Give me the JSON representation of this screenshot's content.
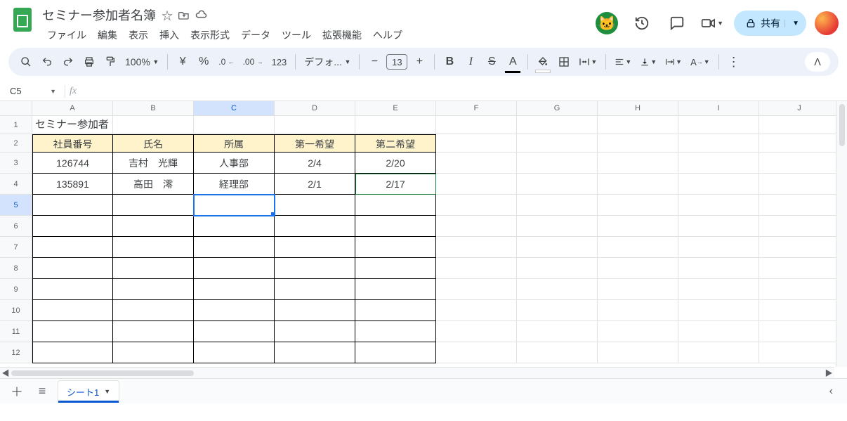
{
  "doc": {
    "title": "セミナー参加者名簿"
  },
  "menu": {
    "file": "ファイル",
    "edit": "編集",
    "view": "表示",
    "insert": "挿入",
    "format": "表示形式",
    "data": "データ",
    "tools": "ツール",
    "extensions": "拡張機能",
    "help": "ヘルプ"
  },
  "toolbar": {
    "zoom": "100%",
    "currency": "¥",
    "percent": "%",
    "dec_dec": ".0",
    "inc_dec": ".00",
    "numfmt": "123",
    "font": "デフォ...",
    "minus": "−",
    "fontsize": "13",
    "plus": "+",
    "bold": "B",
    "italic": "I",
    "strike": "S",
    "textcolor": "A",
    "more": "⋮"
  },
  "share": {
    "label": "共有"
  },
  "namebox": {
    "cell": "C5"
  },
  "columns": [
    "A",
    "B",
    "C",
    "D",
    "E",
    "F",
    "G",
    "H",
    "I",
    "J"
  ],
  "rows": [
    "1",
    "2",
    "3",
    "4",
    "5",
    "6",
    "7",
    "8",
    "9",
    "10",
    "11",
    "12"
  ],
  "sheet": {
    "title_cell": "セミナー参加者",
    "headers": [
      "社員番号",
      "氏名",
      "所属",
      "第一希望",
      "第二希望"
    ],
    "data": [
      [
        "126744",
        "吉村　光輝",
        "人事部",
        "2/4",
        "2/20"
      ],
      [
        "135891",
        "高田　澪",
        "経理部",
        "2/1",
        "2/17"
      ]
    ]
  },
  "tabs": {
    "sheet1": "シート1"
  }
}
